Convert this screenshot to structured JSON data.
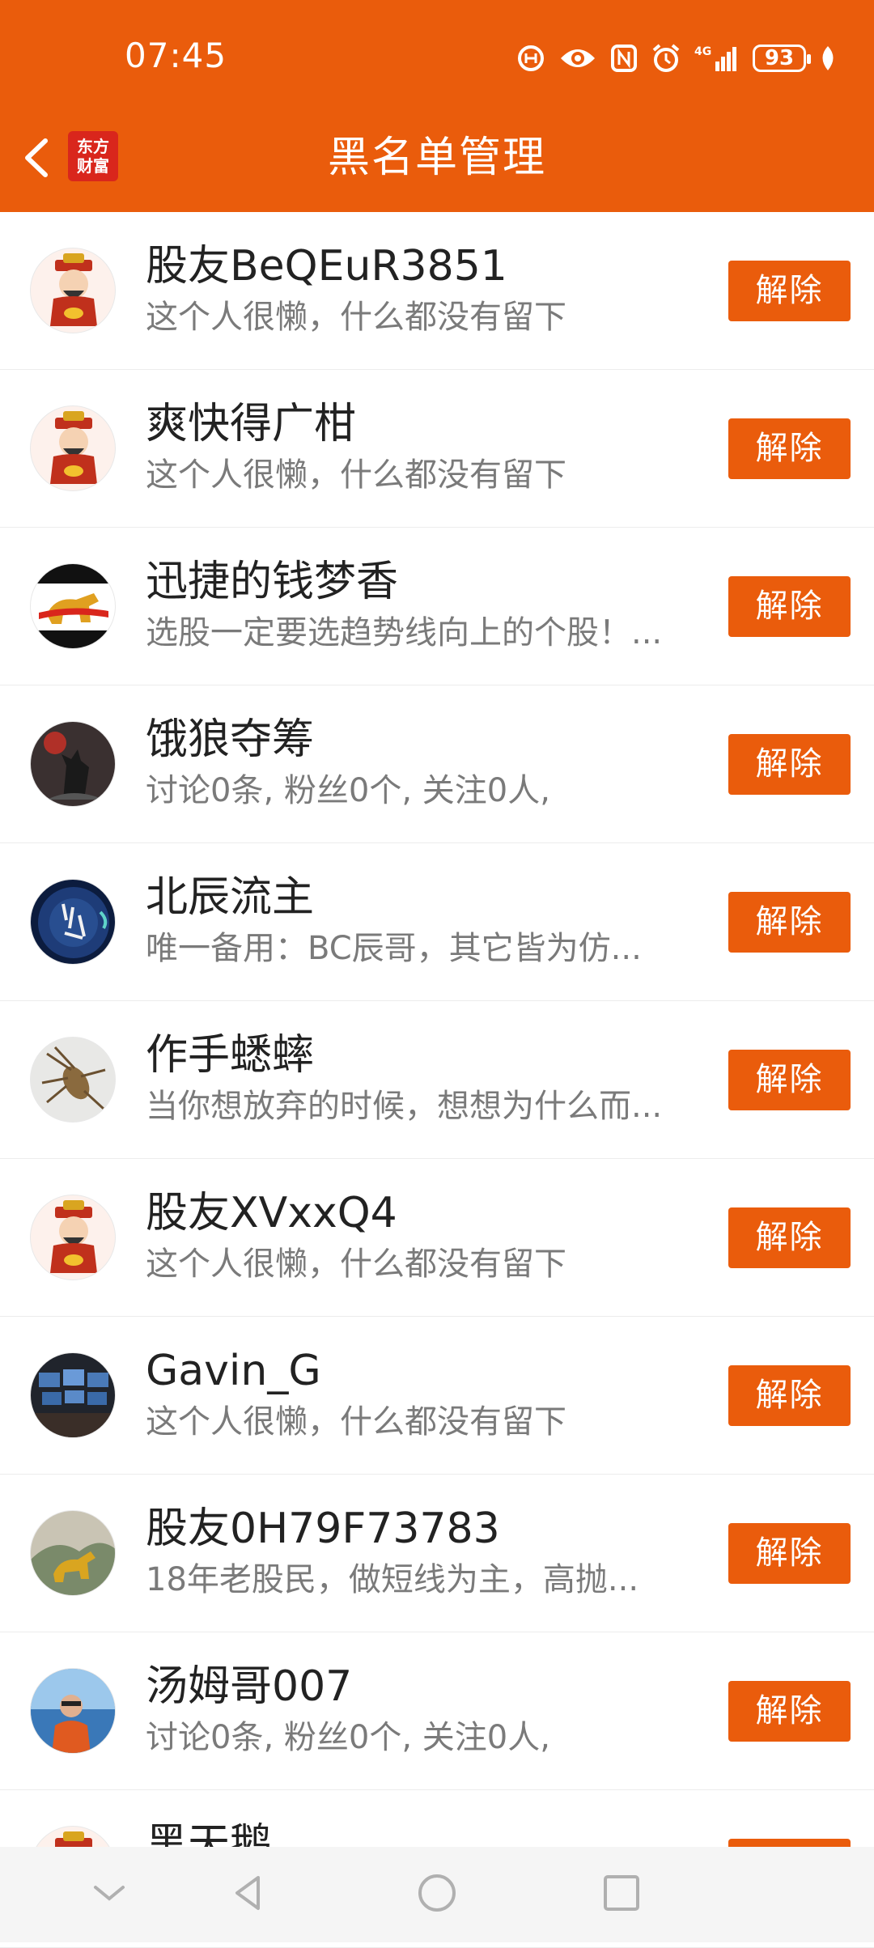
{
  "status_bar": {
    "time": "07:45",
    "battery": "93"
  },
  "header": {
    "title": "黑名单管理",
    "logo_line1": "东方",
    "logo_line2": "财富"
  },
  "rows": [
    {
      "name": "股友BeQEuR3851",
      "bio": "这个人很懒，什么都没有留下",
      "button": "解除",
      "avatar": "god-of-wealth"
    },
    {
      "name": "爽快得广柑",
      "bio": "这个人很懒，什么都没有留下",
      "button": "解除",
      "avatar": "god-of-wealth"
    },
    {
      "name": "迅捷的钱梦香",
      "bio": "选股一定要选趋势线向上的个股！...",
      "button": "解除",
      "avatar": "bull"
    },
    {
      "name": "饿狼夺筹",
      "bio": "讨论0条, 粉丝0个, 关注0人,",
      "button": "解除",
      "avatar": "wolf"
    },
    {
      "name": "北辰流主",
      "bio": "唯一备用：BC辰哥，其它皆为仿...",
      "button": "解除",
      "avatar": "space-calligraphy"
    },
    {
      "name": "作手蟋蟀",
      "bio": "当你想放弃的时候，想想为什么而...",
      "button": "解除",
      "avatar": "cricket"
    },
    {
      "name": "股友XVxxQ4",
      "bio": "这个人很懒，什么都没有留下",
      "button": "解除",
      "avatar": "god-of-wealth"
    },
    {
      "name": "Gavin_G",
      "bio": "这个人很懒，什么都没有留下",
      "button": "解除",
      "avatar": "trading-desk"
    },
    {
      "name": "股友0H79F73783",
      "bio": "18年老股民，做短线为主，高抛...",
      "button": "解除",
      "avatar": "golden-bull"
    },
    {
      "name": "汤姆哥007",
      "bio": "讨论0条, 粉丝0个, 关注0人,",
      "button": "解除",
      "avatar": "man-on-boat"
    },
    {
      "name": "黑天鹅",
      "bio": "",
      "button": "解除",
      "avatar": "god-of-wealth"
    }
  ]
}
